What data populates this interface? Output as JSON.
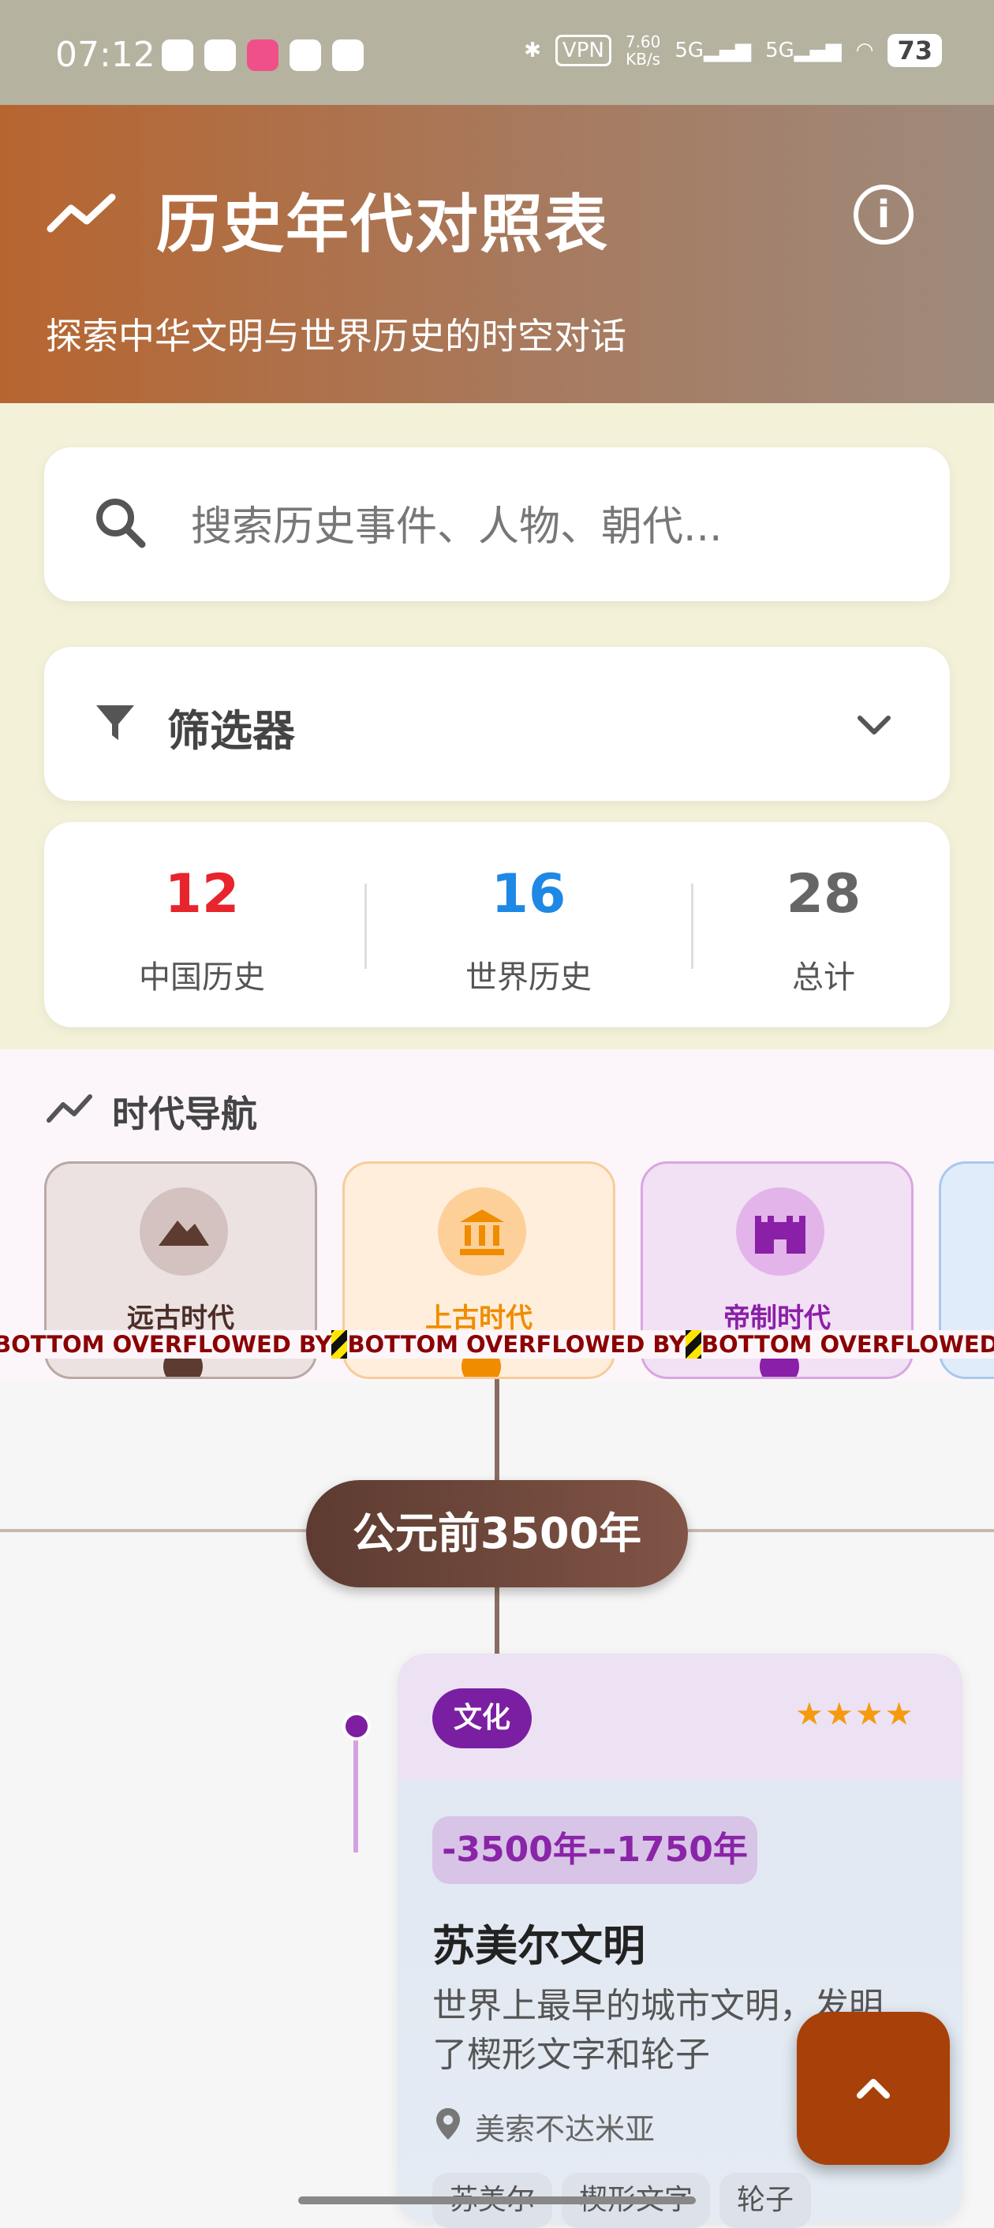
{
  "status_bar": {
    "time": "07:12",
    "vpn": "VPN",
    "speed_value": "7.60",
    "speed_unit": "KB/s",
    "network1": "5G",
    "network2": "5G",
    "battery": "73"
  },
  "header": {
    "title": "历史年代对照表",
    "subtitle": "探索中华文明与世界历史的时空对话"
  },
  "search": {
    "placeholder": "搜索历史事件、人物、朝代..."
  },
  "filter": {
    "label": "筛选器"
  },
  "stats": [
    {
      "value": "12",
      "label": "中国历史",
      "color": "#e8242c"
    },
    {
      "value": "16",
      "label": "世界历史",
      "color": "#1e88e5"
    },
    {
      "value": "28",
      "label": "总计",
      "color": "#666666"
    }
  ],
  "era_nav": {
    "title": "时代导航",
    "eras": [
      {
        "label": "远古时代",
        "icon": "mountain-icon",
        "color": "#5d3b31"
      },
      {
        "label": "上古时代",
        "icon": "museum-icon",
        "color": "#f08c00"
      },
      {
        "label": "帝制时代",
        "icon": "castle-icon",
        "color": "#8a1fa8"
      }
    ],
    "overflow_text": "BOTTOM OVERFLOWED BY "
  },
  "timeline": {
    "year": "公元前3500年",
    "event": {
      "category": "文化",
      "rating": 4,
      "stars": "★★★★",
      "date_range": "-3500年--1750年",
      "title": "苏美尔文明",
      "description": "世界上最早的城市文明，发明了楔形文字和轮子",
      "location": "美索不达米亚",
      "tags": [
        "苏美尔",
        "楔形文字",
        "轮子"
      ]
    }
  }
}
